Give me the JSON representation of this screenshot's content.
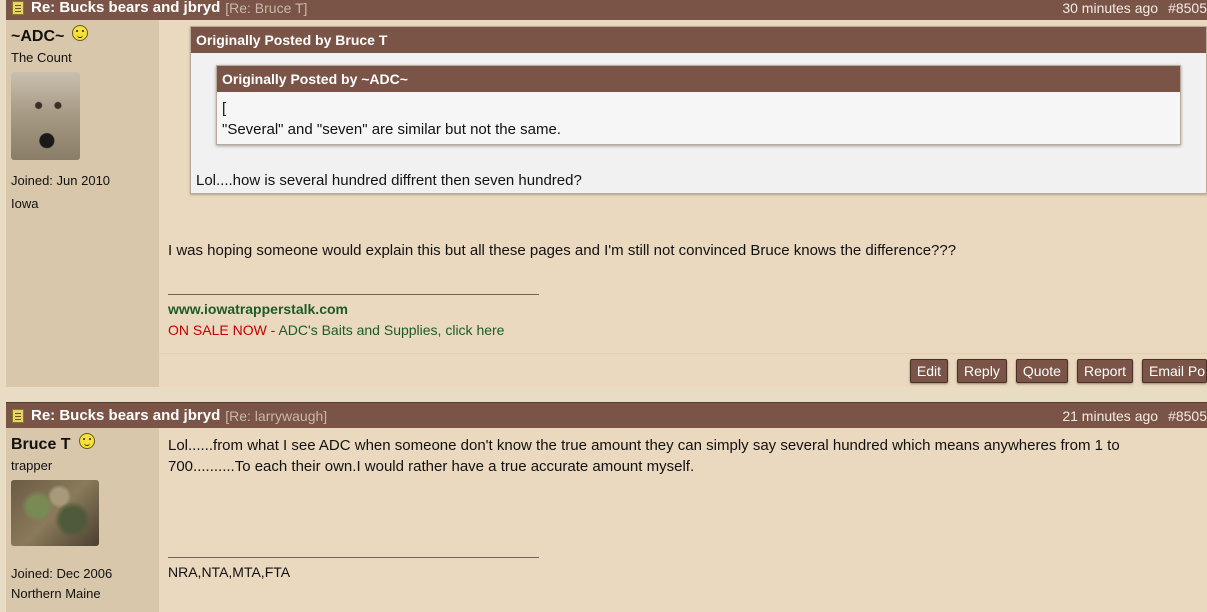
{
  "post1": {
    "header": {
      "title": "Re: Bucks bears and jbryd",
      "re": "[Re: Bruce T]",
      "time": "30 minutes ago",
      "number": "#8505"
    },
    "author": {
      "name": "~ADC~",
      "title": "The Count",
      "joined": "Joined: Jun 2010",
      "location": "Iowa"
    },
    "quote_outer": {
      "heading": "Originally Posted by Bruce T",
      "after_text": "Lol....how is several hundred diffrent then seven hundred?"
    },
    "quote_inner": {
      "heading": "Originally Posted by ~ADC~",
      "line1": "[",
      "line2": "\"Several\" and \"seven\" are similar but not the same."
    },
    "body": "I was hoping someone would explain this but all these pages and I'm still not convinced Bruce knows the difference???",
    "signature": {
      "site": "www.iowatrapperstalk.com",
      "sale_prefix": "ON SALE NOW",
      "sale_sep": " - ",
      "sale_link": "ADC's Baits and Supplies, click here"
    },
    "buttons": {
      "edit": "Edit",
      "reply": "Reply",
      "quote": "Quote",
      "report": "Report",
      "email": "Email Po"
    }
  },
  "post2": {
    "header": {
      "title": "Re: Bucks bears and jbryd",
      "re": "[Re: larrywaugh]",
      "time": "21 minutes ago",
      "number": "#8505"
    },
    "author": {
      "name": "Bruce T",
      "title": "trapper",
      "joined": "Joined: Dec 2006",
      "location": "Northern Maine"
    },
    "body": "Lol......from what I see ADC when someone don't know the true amount they can simply say several hundred which means anywheres from 1 to 700..........To each their own.I would rather have a true accurate amount myself.",
    "signature": "NRA,NTA,MTA,FTA"
  },
  "colors": {
    "header_bg": "#7a5446",
    "page_bg": "#e9dcc4",
    "sidebar_bg": "#d8c7aa",
    "link_green": "#1d5a2a",
    "sale_red": "#c40000"
  }
}
